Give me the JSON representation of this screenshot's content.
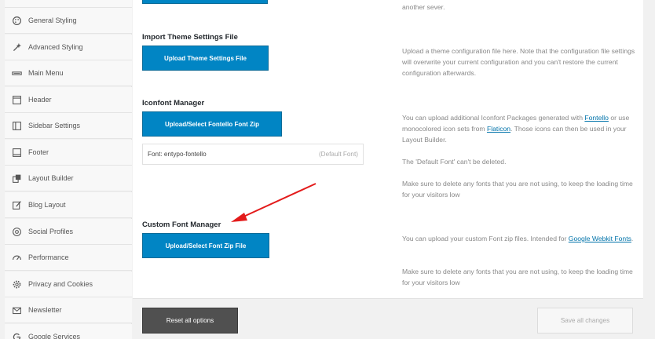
{
  "sidebar": {
    "items": [
      {
        "label": "General Styling",
        "icon": "brush-icon"
      },
      {
        "label": "Advanced Styling",
        "icon": "magic-wand-icon"
      },
      {
        "label": "Main Menu",
        "icon": "menu-bar-icon"
      },
      {
        "label": "Header",
        "icon": "header-layout-icon"
      },
      {
        "label": "Sidebar Settings",
        "icon": "sidebar-layout-icon"
      },
      {
        "label": "Footer",
        "icon": "footer-layout-icon"
      },
      {
        "label": "Layout Builder",
        "icon": "layout-builder-icon"
      },
      {
        "label": "Blog Layout",
        "icon": "blog-edit-icon"
      },
      {
        "label": "Social Profiles",
        "icon": "at-sign-icon"
      },
      {
        "label": "Performance",
        "icon": "speedometer-icon"
      },
      {
        "label": "Privacy and Cookies",
        "icon": "gear-icon"
      },
      {
        "label": "Newsletter",
        "icon": "envelope-icon"
      },
      {
        "label": "Google Services",
        "icon": "google-icon"
      }
    ]
  },
  "top_text": "another sever.",
  "import_theme": {
    "title": "Import Theme Settings File",
    "button": "Upload Theme Settings File",
    "description": "Upload a theme configuration file here. Note that the configuration file settings will overwrite your current configuration and you can't restore the current configuration afterwards."
  },
  "iconfont": {
    "title": "Iconfont Manager",
    "button": "Upload/Select Fontello Font Zip",
    "font_name": "Font: entypo-fontello",
    "font_tag": "(Default Font)",
    "desc_part1": "You can upload additional Iconfont Packages generated with ",
    "link_fontello": "Fontello",
    "desc_part2": " or use monocolored icon sets from ",
    "link_flaticon": "Flaticon",
    "desc_part3": ". Those icons can then be used in your Layout Builder.",
    "desc_default": "The 'Default Font' can't be deleted.",
    "desc_delete": "Make sure to delete any fonts that you are not using, to keep the loading time for your visitors low"
  },
  "custom_font": {
    "title": "Custom Font Manager",
    "button": "Upload/Select Font Zip File",
    "desc_part1": "You can upload your custom Font zip files. Intended for ",
    "link_google": "Google Webkit Fonts",
    "desc_part2": ".",
    "desc_delete": "Make sure to delete any fonts that you are not using, to keep the loading time for your visitors low"
  },
  "footer": {
    "reset_label": "Reset all options",
    "save_label": "Save all changes"
  },
  "colors": {
    "accent_blue": "#0185c4",
    "annotation_arrow": "#e31b1b",
    "reset_button": "#505050"
  }
}
